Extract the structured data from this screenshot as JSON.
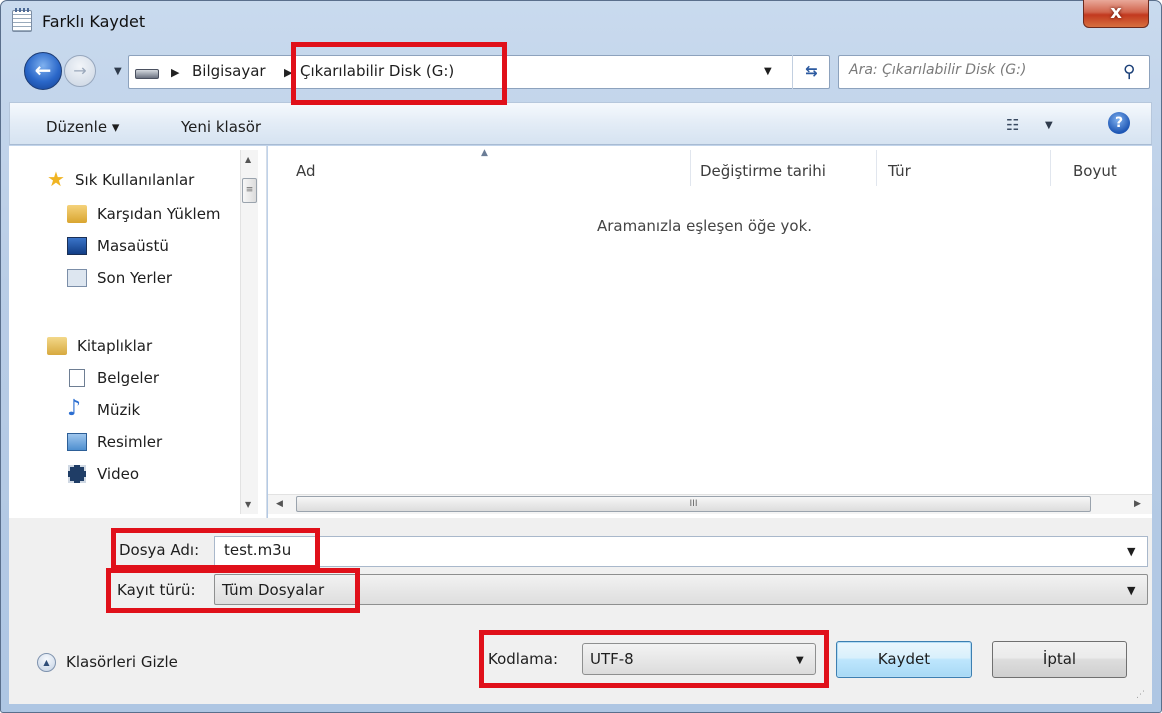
{
  "window": {
    "title": "Farklı Kaydet",
    "close_label": "x"
  },
  "address": {
    "back_label": "←",
    "forward_label": "→",
    "breadcrumbs": [
      "Bilgisayar",
      "Çıkarılabilir Disk (G:)"
    ],
    "search_placeholder": "Ara: Çıkarılabilir Disk (G:)"
  },
  "toolbar": {
    "organize_label": "Düzenle ▾",
    "new_folder_label": "Yeni klasör",
    "help_label": "?"
  },
  "nav": {
    "favorites": {
      "label": "Sık Kullanılanlar",
      "items": [
        {
          "label": "Karşıdan Yüklem"
        },
        {
          "label": "Masaüstü"
        },
        {
          "label": "Son Yerler"
        }
      ]
    },
    "libraries": {
      "label": "Kitaplıklar",
      "items": [
        {
          "label": "Belgeler"
        },
        {
          "label": "Müzik"
        },
        {
          "label": "Resimler"
        },
        {
          "label": "Video"
        }
      ]
    }
  },
  "file_list": {
    "columns": [
      "Ad",
      "Değiştirme tarihi",
      "Tür",
      "Boyut"
    ],
    "empty_message": "Aramanızla eşleşen öğe yok."
  },
  "form": {
    "filename_label": "Dosya Adı:",
    "filename_value": "test.m3u",
    "type_label": "Kayıt türü:",
    "type_value": "Tüm Dosyalar",
    "encoding_label": "Kodlama:",
    "encoding_value": "UTF-8"
  },
  "footer": {
    "hide_folders_label": "Klasörleri Gizle",
    "save_label": "Kaydet",
    "cancel_label": "İptal"
  },
  "colors": {
    "highlight": "#e0101a",
    "window_frame": "#b9cde6",
    "accent": "#1d56b4"
  }
}
